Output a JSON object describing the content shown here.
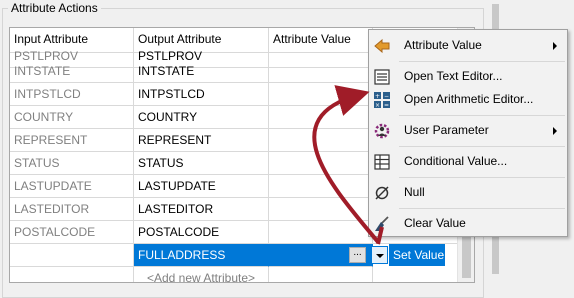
{
  "group": {
    "title": "Attribute Actions"
  },
  "columns": [
    "Input Attribute",
    "Output Attribute",
    "Attribute Value",
    ""
  ],
  "rows": [
    {
      "input": "PSTLPROV",
      "output": "PSTLPROV"
    },
    {
      "input": "INTSTATE",
      "output": "INTSTATE"
    },
    {
      "input": "INTPSTLCD",
      "output": "INTPSTLCD"
    },
    {
      "input": "COUNTRY",
      "output": "COUNTRY"
    },
    {
      "input": "REPRESENT",
      "output": "REPRESENT"
    },
    {
      "input": "STATUS",
      "output": "STATUS"
    },
    {
      "input": "LASTUPDATE",
      "output": "LASTUPDATE"
    },
    {
      "input": "LASTEDITOR",
      "output": "LASTEDITOR"
    },
    {
      "input": "POSTALCODE",
      "output": "POSTALCODE"
    }
  ],
  "selected_row": {
    "input": "",
    "output": "FULLADDRESS",
    "action": "Set Value",
    "ellipsis": "..."
  },
  "add_row": {
    "label": "<Add new Attribute>"
  },
  "menu": {
    "items": [
      {
        "label": "Attribute Value",
        "icon": "attribute-value-icon",
        "submenu": true
      },
      {
        "label": "Open Text Editor...",
        "icon": "text-editor-icon",
        "submenu": false
      },
      {
        "label": "Open Arithmetic Editor...",
        "icon": "arithmetic-editor-icon",
        "submenu": false
      },
      {
        "label": "User Parameter",
        "icon": "user-parameter-icon",
        "submenu": true
      },
      {
        "label": "Conditional Value...",
        "icon": "conditional-table-icon",
        "submenu": false
      },
      {
        "label": "Null",
        "icon": "null-icon",
        "submenu": false
      },
      {
        "label": "Clear Value",
        "icon": "broom-icon",
        "submenu": false
      }
    ]
  },
  "colors": {
    "selection": "#0078d7",
    "annotation_arrow": "#a01c28",
    "inactive_text": "#808080"
  }
}
